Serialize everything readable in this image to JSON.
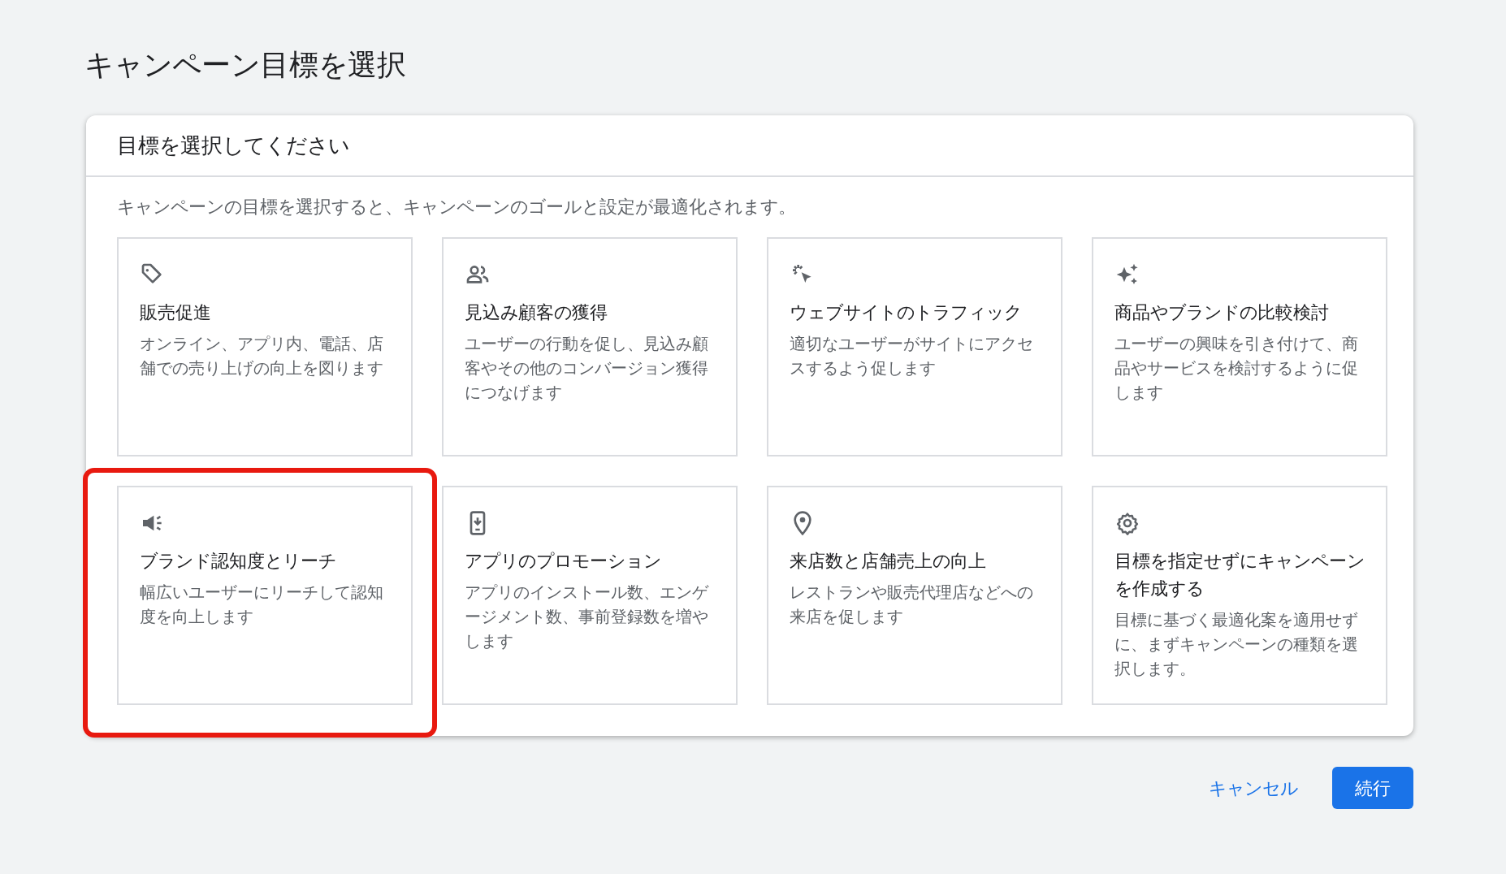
{
  "page_title": "キャンペーン目標を選択",
  "panel": {
    "header": "目標を選択してください",
    "intro": "キャンペーンの目標を選択すると、キャンペーンのゴールと設定が最適化されます。",
    "cards": [
      {
        "title": "販売促進",
        "description": "オンライン、アプリ内、電話、店舗での売り上げの向上を図ります",
        "highlighted": false
      },
      {
        "title": "見込み顧客の獲得",
        "description": "ユーザーの行動を促し、見込み顧客やその他のコンバージョン獲得につなげます",
        "highlighted": false
      },
      {
        "title": "ウェブサイトのトラフィック",
        "description": "適切なユーザーがサイトにアクセスするよう促します",
        "highlighted": false
      },
      {
        "title": "商品やブランドの比較検討",
        "description": "ユーザーの興味を引き付けて、商品やサービスを検討するように促します",
        "highlighted": false
      },
      {
        "title": "ブランド認知度とリーチ",
        "description": "幅広いユーザーにリーチして認知度を向上します",
        "highlighted": true
      },
      {
        "title": "アプリのプロモーション",
        "description": "アプリのインストール数、エンゲージメント数、事前登録数を増やします",
        "highlighted": false
      },
      {
        "title": "来店数と店舗売上の向上",
        "description": "レストランや販売代理店などへの来店を促します",
        "highlighted": false
      },
      {
        "title": "目標を指定せずにキャンペーンを作成する",
        "description": "目標に基づく最適化案を適用せずに、まずキャンペーンの種類を選択します。",
        "highlighted": false
      }
    ]
  },
  "buttons": [
    {
      "kind": "text",
      "label": "キャンセル"
    },
    {
      "kind": "primary",
      "label": "続行"
    }
  ]
}
